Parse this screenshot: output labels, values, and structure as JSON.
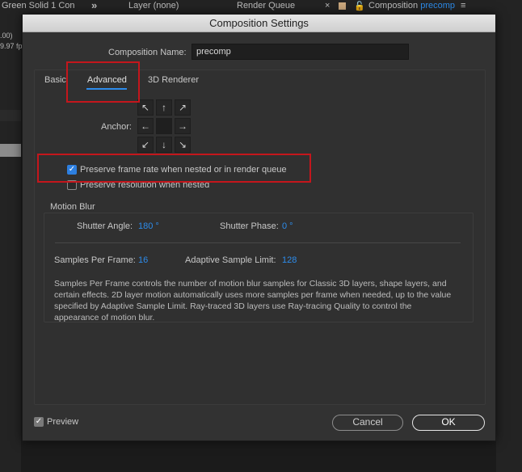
{
  "background": {
    "tabs": [
      "Green Solid 1 Con",
      "Layer (none)",
      "Render Queue",
      "Composition"
    ],
    "composition_name": "precomp",
    "left_values": [
      ".00)",
      "9.97 fp"
    ]
  },
  "dialog": {
    "title": "Composition Settings",
    "name_label": "Composition Name:",
    "name_value": "precomp",
    "tabs": [
      "Basic",
      "Advanced",
      "3D Renderer"
    ],
    "active_tab": "Advanced",
    "anchor_label": "Anchor:",
    "anchor_arrows": [
      "↖",
      "↑",
      "↗",
      "←",
      "",
      "→",
      "↙",
      "↓",
      "↘"
    ],
    "checkboxes": [
      {
        "label": "Preserve frame rate when nested or in render queue",
        "checked": true
      },
      {
        "label": "Preserve resolution when nested",
        "checked": false
      }
    ],
    "motion_blur": {
      "title": "Motion Blur",
      "shutter_angle_label": "Shutter Angle:",
      "shutter_angle_value": "180 °",
      "shutter_phase_label": "Shutter Phase:",
      "shutter_phase_value": "0 °",
      "samples_label": "Samples Per Frame:",
      "samples_value": "16",
      "adaptive_label": "Adaptive Sample Limit:",
      "adaptive_value": "128",
      "description": "Samples Per Frame controls the number of motion blur samples for Classic 3D layers, shape layers, and certain effects. 2D layer motion automatically uses more samples per frame when needed, up to the value specified by Adaptive Sample Limit. Ray-traced 3D layers use Ray-tracing Quality to control the appearance of motion blur."
    },
    "preview_label": "Preview",
    "preview_checked": true,
    "cancel_label": "Cancel",
    "ok_label": "OK"
  },
  "colors": {
    "accent": "#2d8ceb",
    "highlight": "#c4161c",
    "dialog_bg": "#323232"
  }
}
